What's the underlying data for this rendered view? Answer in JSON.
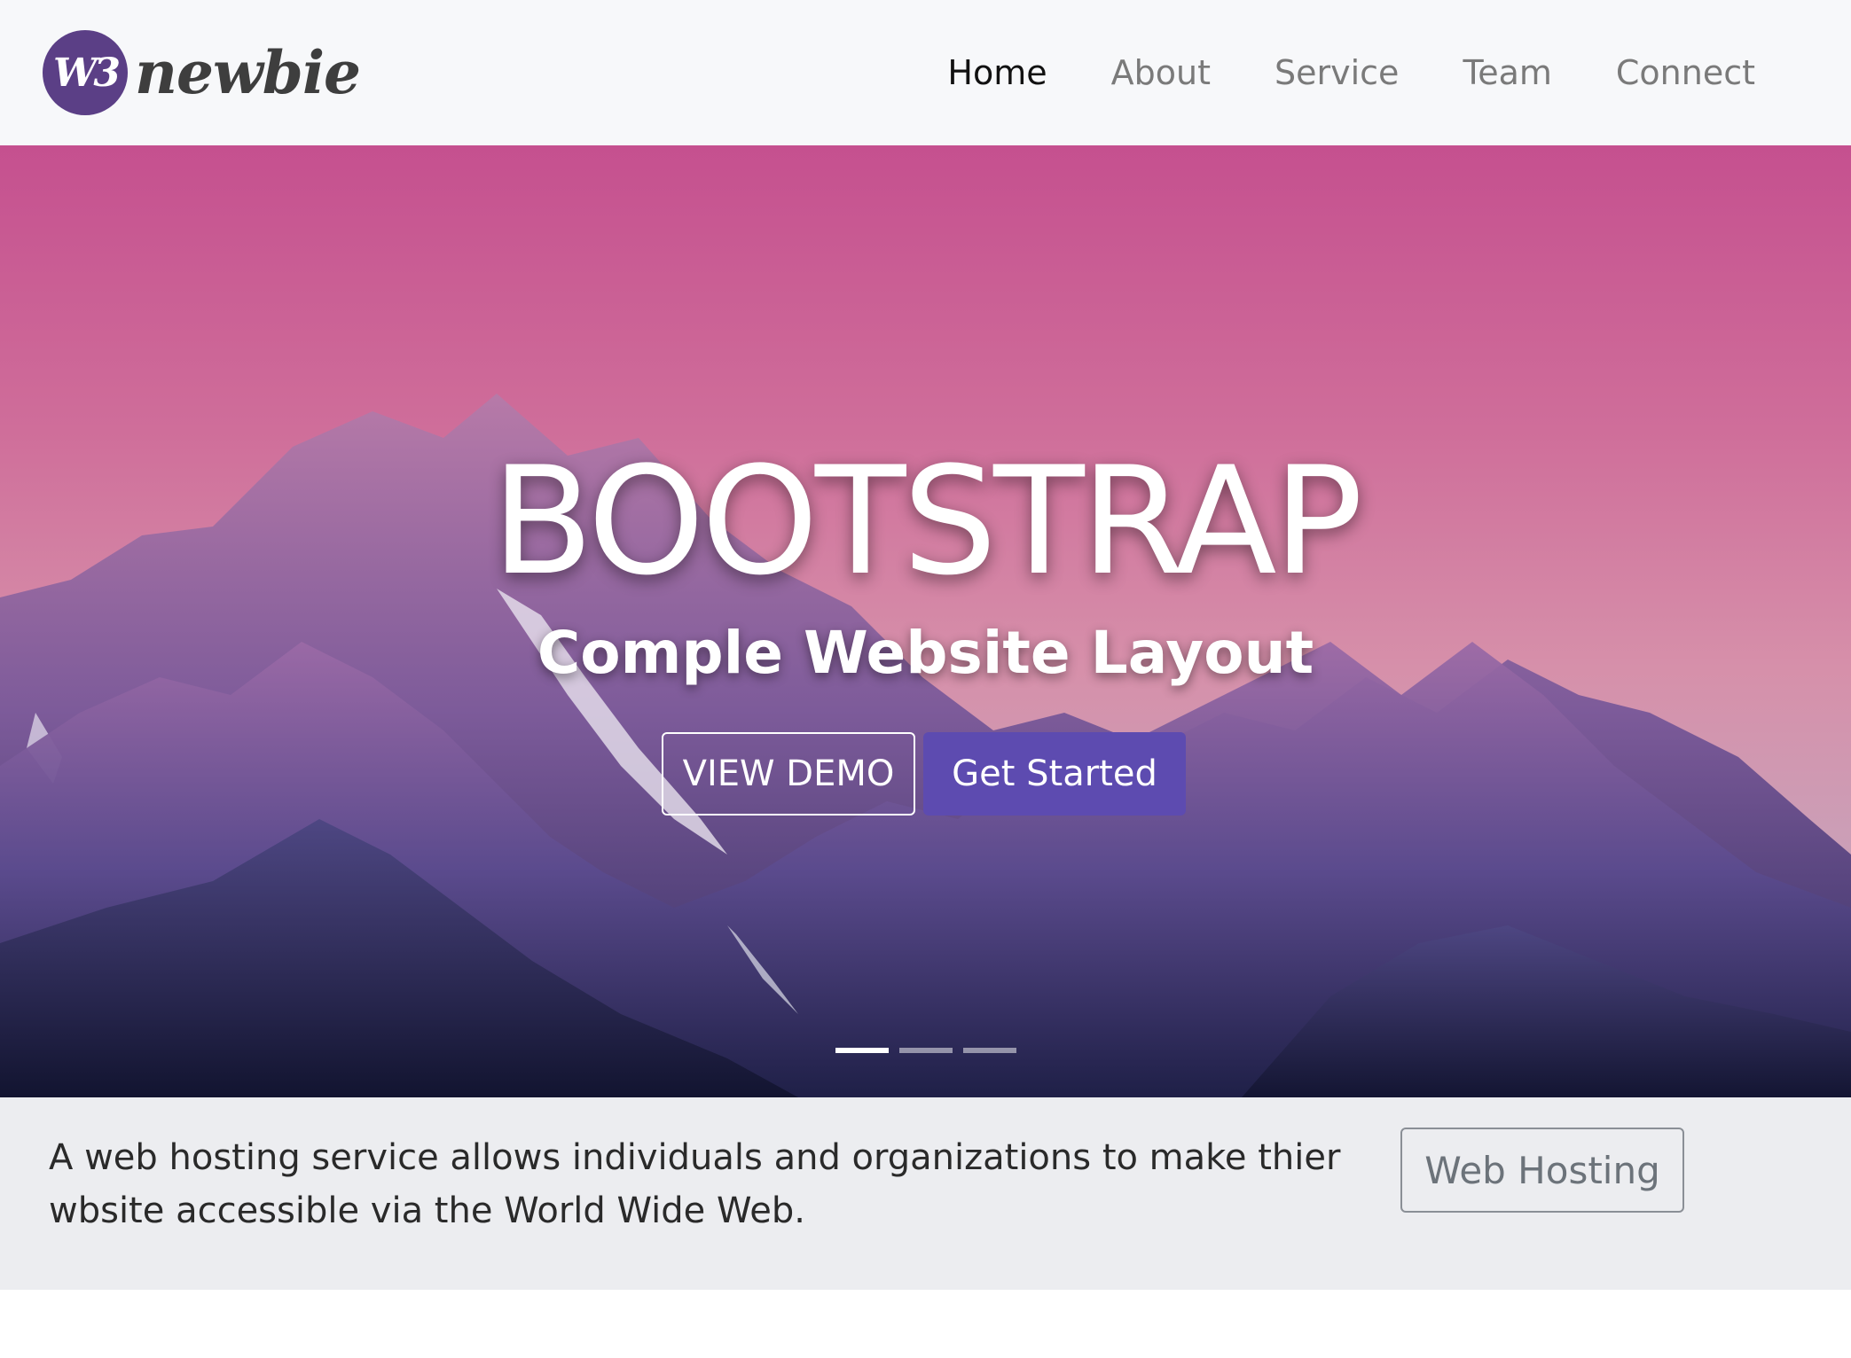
{
  "brand": {
    "badge_text": "W3",
    "name": "newbie",
    "badge_color": "#5b3f86"
  },
  "nav": {
    "items": [
      {
        "label": "Home",
        "active": true
      },
      {
        "label": "About",
        "active": false
      },
      {
        "label": "Service",
        "active": false
      },
      {
        "label": "Team",
        "active": false
      },
      {
        "label": "Connect",
        "active": false
      }
    ]
  },
  "hero": {
    "title": "BOOTSTRAP",
    "subtitle": "Comple Website Layout",
    "demo_button": "VIEW DEMO",
    "start_button": "Get Started",
    "accent_color": "#5d4bb0",
    "slides_total": 3,
    "active_slide": 1
  },
  "info": {
    "text": "A web hosting service allows individuals and organizations to make thier wbsite accessible via the World Wide Web.",
    "button": "Web Hosting"
  }
}
